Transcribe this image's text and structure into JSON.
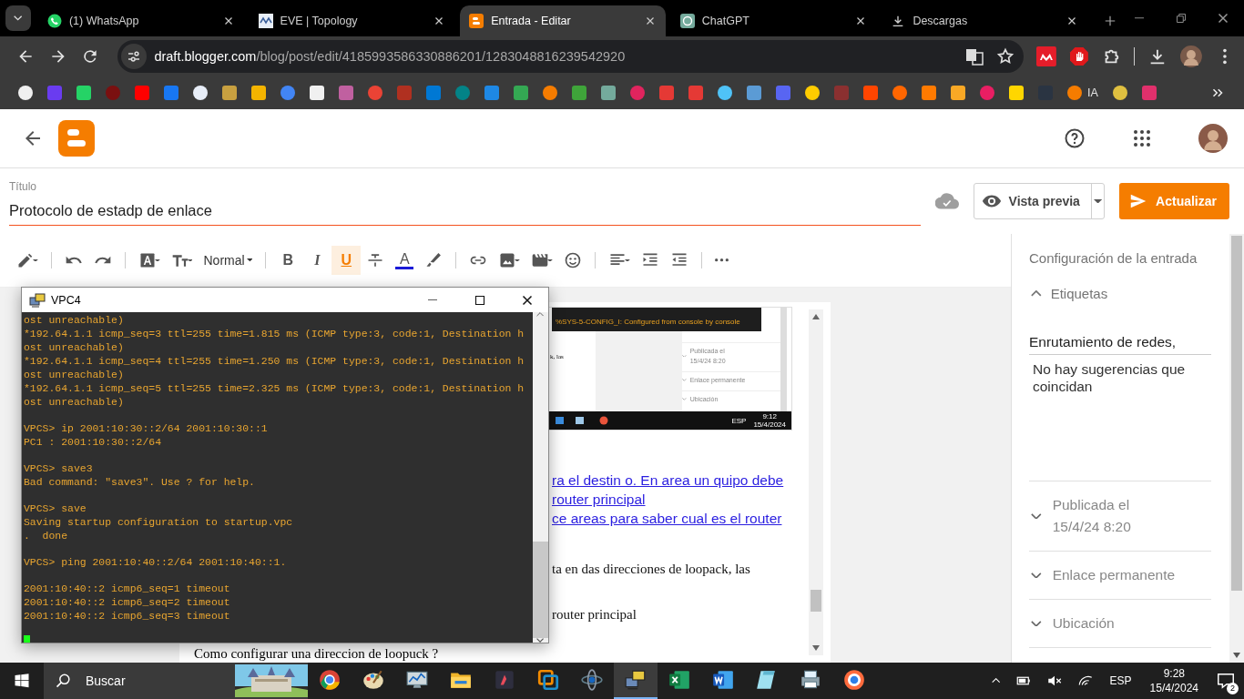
{
  "browser": {
    "tabs": [
      {
        "title": "(1) WhatsApp",
        "selected": false
      },
      {
        "title": "EVE | Topology",
        "selected": false
      },
      {
        "title": "Entrada - Editar",
        "selected": true
      },
      {
        "title": "ChatGPT",
        "selected": false
      },
      {
        "title": "Descargas",
        "selected": false
      }
    ],
    "url": {
      "host": "draft.blogger.com",
      "path": "/blog/post/edit/4185993586330886201/1283048816239542920"
    },
    "bookmark_folder": "IA"
  },
  "post": {
    "title_label": "Título",
    "title": "Protocolo de estadp de enlace",
    "preview_button": "Vista previa",
    "update_button": "Actualizar"
  },
  "toolbar": {
    "paragraph_style": "Normal",
    "format_buttons": [
      {
        "kind": "bold",
        "label": "B",
        "active": false
      },
      {
        "kind": "italic",
        "label": "I",
        "active": false
      },
      {
        "kind": "underline",
        "label": "U",
        "active": true
      },
      {
        "kind": "strike",
        "active": false
      },
      {
        "kind": "color",
        "label": "A",
        "active": false
      }
    ]
  },
  "editor": {
    "embedded_screenshot": {
      "console_line": "%SYS-5-CONFIG_I: Configured from console by console",
      "text_fragment": "k, las",
      "sections": [
        {
          "title": "Publicada el",
          "detail": "15/4/24 8:20"
        },
        {
          "title": "Enlace permanente"
        },
        {
          "title": "Ubicación"
        }
      ],
      "language": "ESP",
      "time": "9:12",
      "date": "15/4/2024"
    },
    "lines": [
      {
        "kind": "link",
        "text": "ra el destin o. En area un quipo debe "
      },
      {
        "kind": "link",
        "text": "router principal"
      },
      {
        "kind": "link",
        "text": "ce areas para saber cual es el router "
      },
      {
        "kind": "text",
        "text": "ta en das direcciones de loopack, las"
      },
      {
        "kind": "text",
        "text": "router principal"
      },
      {
        "kind": "heading",
        "text": "Como configurar una direccion de loopuck ?"
      }
    ]
  },
  "terminal": {
    "title": "VPC4",
    "blocks": [
      [
        "ost unreachable)",
        "*192.64.1.1 icmp_seq=3 ttl=255 time=1.815 ms (ICMP type:3, code:1, Destination h",
        "ost unreachable)",
        "*192.64.1.1 icmp_seq=4 ttl=255 time=1.250 ms (ICMP type:3, code:1, Destination h",
        "ost unreachable)",
        "*192.64.1.1 icmp_seq=5 ttl=255 time=2.325 ms (ICMP type:3, code:1, Destination h",
        "ost unreachable)"
      ],
      [
        "VPCS> ip 2001:10:30::2/64 2001:10:30::1",
        "PC1 : 2001:10:30::2/64"
      ],
      [
        "VPCS> save3",
        "Bad command: \"save3\". Use ? for help."
      ],
      [
        "VPCS> save",
        "Saving startup configuration to startup.vpc",
        ".  done"
      ],
      [
        "VPCS> ping 2001:10:40::2/64 2001:10:40::1."
      ],
      [
        "2001:10:40::2 icmp6_seq=1 timeout",
        "2001:10:40::2 icmp6_seq=2 timeout",
        "2001:10:40::2 icmp6_seq=3 timeout"
      ]
    ]
  },
  "sidebar": {
    "heading": "Configuración de la entrada",
    "labels": {
      "title": "Etiquetas",
      "expanded": true,
      "value": "Enrutamiento de redes,",
      "suggestion": "No hay sugerencias que coincidan"
    },
    "sections": [
      {
        "title": "Publicada el",
        "detail": "15/4/24 8:20",
        "expanded": false
      },
      {
        "title": "Enlace permanente",
        "expanded": false
      },
      {
        "title": "Ubicación",
        "expanded": false
      }
    ]
  },
  "taskbar": {
    "search": "Buscar",
    "apps": [
      {
        "kind": "chrome",
        "active": false
      },
      {
        "kind": "paint",
        "active": false
      },
      {
        "kind": "monitor",
        "active": false
      },
      {
        "kind": "folder",
        "active": false
      },
      {
        "kind": "terminal",
        "active": false
      },
      {
        "kind": "vmware",
        "active": false
      },
      {
        "kind": "network",
        "active": false
      },
      {
        "kind": "vpcs",
        "active": true
      },
      {
        "kind": "excel",
        "active": false
      },
      {
        "kind": "word",
        "active": false
      },
      {
        "kind": "notepad",
        "active": false
      },
      {
        "kind": "printer",
        "active": false
      },
      {
        "kind": "browser",
        "active": false
      }
    ],
    "language": "ESP",
    "time": "9:28",
    "date": "15/4/2024",
    "notifications": "2"
  }
}
